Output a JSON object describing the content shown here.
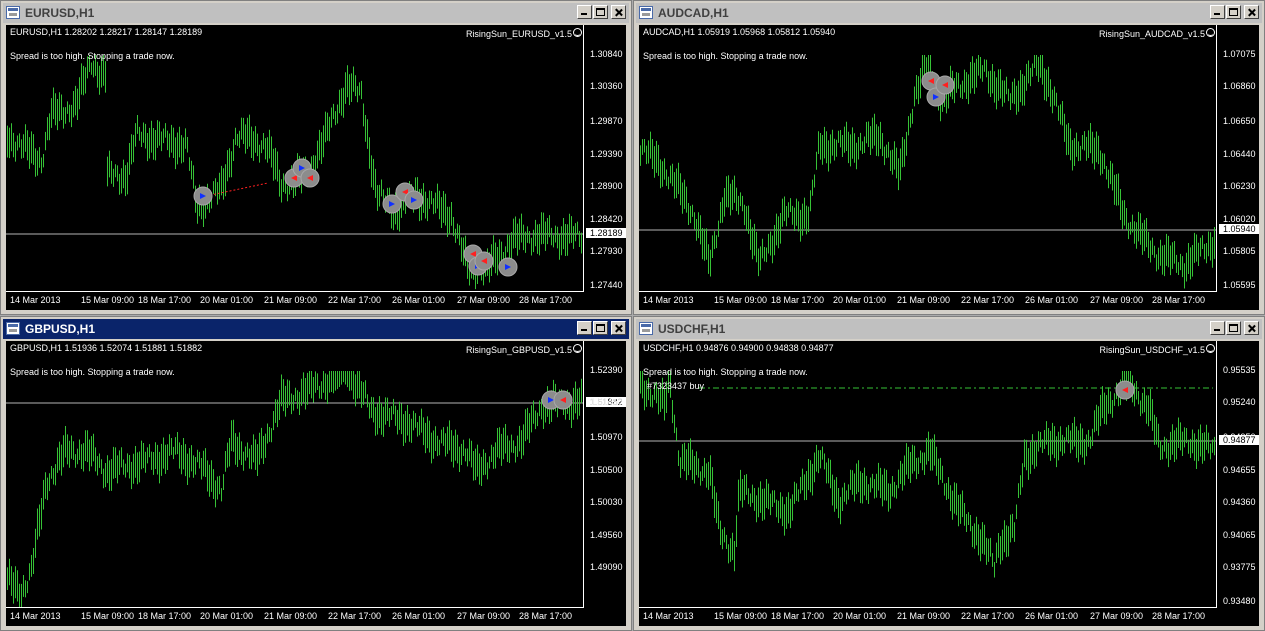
{
  "charts": [
    {
      "window_title": "EURUSD,H1",
      "info": "EURUSD,H1  1.28202 1.28217 1.28147 1.28189",
      "ea_label": "RisingSun_EURUSD_v1.5",
      "message": "Spread is too high. Stopping a trade now.",
      "order_label": "",
      "prices": [
        "1.30840",
        "1.30360",
        "1.29870",
        "1.29390",
        "1.28900",
        "1.28420",
        "1.27930",
        "1.27440"
      ],
      "current_price": "1.28189",
      "times": [
        "14 Mar 2013",
        "15 Mar 09:00",
        "18 Mar 17:00",
        "20 Mar 01:00",
        "21 Mar 09:00",
        "22 Mar 17:00",
        "26 Mar 01:00",
        "27 Mar 09:00",
        "28 Mar 17:00"
      ],
      "colors": {
        "candle": "#36c236",
        "grid": "#b4b4b4"
      }
    },
    {
      "window_title": "AUDCAD,H1",
      "info": "AUDCAD,H1  1.05919 1.05968 1.05812 1.05940",
      "ea_label": "RisingSun_AUDCAD_v1.5",
      "message": "Spread is too high. Stopping a trade now.",
      "order_label": "",
      "prices": [
        "1.07075",
        "1.06860",
        "1.06650",
        "1.06440",
        "1.06230",
        "1.06020",
        "1.05805",
        "1.05595"
      ],
      "current_price": "1.05940",
      "times": [
        "14 Mar 2013",
        "15 Mar 09:00",
        "18 Mar 17:00",
        "20 Mar 01:00",
        "21 Mar 09:00",
        "22 Mar 17:00",
        "26 Mar 01:00",
        "27 Mar 09:00",
        "28 Mar 17:00"
      ],
      "colors": {
        "candle": "#36c236",
        "grid": "#b4b4b4"
      }
    },
    {
      "window_title": "GBPUSD,H1",
      "info": "GBPUSD,H1  1.51936 1.52074 1.51881 1.51882",
      "ea_label": "RisingSun_GBPUSD_v1.5",
      "message": "Spread is too high. Stopping a trade now.",
      "order_label": "",
      "prices": [
        "1.52390",
        "1.51882",
        "1.51450",
        "1.50970",
        "1.50500",
        "1.50030",
        "1.49560",
        "1.49090"
      ],
      "current_price": "1.51882",
      "times": [
        "14 Mar 2013",
        "15 Mar 09:00",
        "18 Mar 17:00",
        "20 Mar 01:00",
        "21 Mar 09:00",
        "22 Mar 17:00",
        "26 Mar 01:00",
        "27 Mar 09:00",
        "28 Mar 17:00"
      ],
      "colors": {
        "candle": "#36c236",
        "grid": "#b4b4b4"
      }
    },
    {
      "window_title": "USDCHF,H1",
      "info": "USDCHF,H1  0.94876 0.94900 0.94838 0.94877",
      "ea_label": "RisingSun_USDCHF_v1.5",
      "message": "Spread is too high. Stopping a trade now.",
      "order_label": "#7323437 buy",
      "prices": [
        "0.95535",
        "0.95240",
        "0.94950",
        "0.94655",
        "0.94360",
        "0.94065",
        "0.93775",
        "0.93480"
      ],
      "current_price": "0.94877",
      "times": [
        "14 Mar 2013",
        "15 Mar 09:00",
        "18 Mar 17:00",
        "20 Mar 01:00",
        "21 Mar 09:00",
        "22 Mar 17:00",
        "26 Mar 01:00",
        "27 Mar 09:00",
        "28 Mar 17:00"
      ],
      "colors": {
        "candle": "#36c236",
        "grid": "#b4b4b4"
      }
    }
  ],
  "active_window": "GBPUSD,H1"
}
